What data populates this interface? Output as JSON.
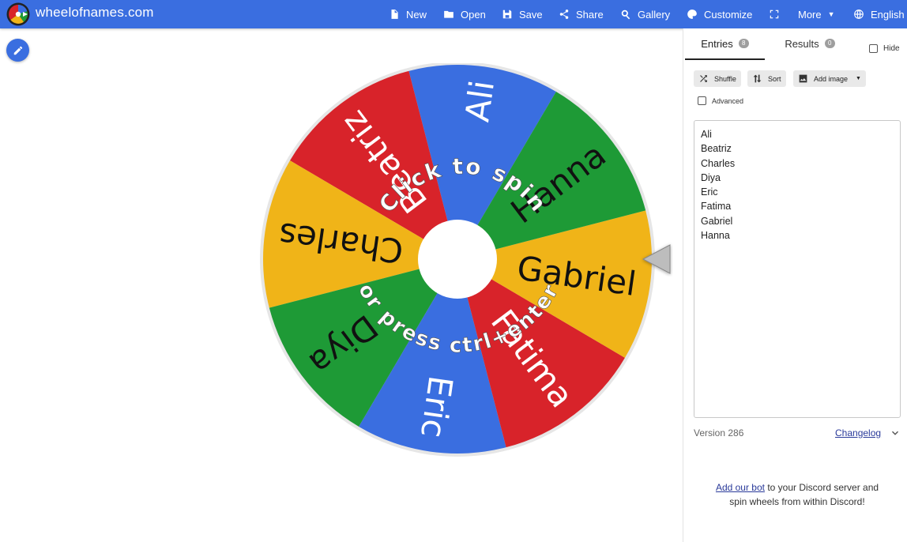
{
  "header": {
    "site_title": "wheelofnames.com",
    "nav": [
      {
        "label": "New",
        "icon": "file-icon"
      },
      {
        "label": "Open",
        "icon": "folder-icon"
      },
      {
        "label": "Save",
        "icon": "save-icon"
      },
      {
        "label": "Share",
        "icon": "share-icon"
      },
      {
        "label": "Gallery",
        "icon": "search-icon"
      },
      {
        "label": "Customize",
        "icon": "palette-icon"
      },
      {
        "label": "",
        "icon": "fullscreen-icon"
      },
      {
        "label": "More",
        "icon": "chevron-down-icon"
      },
      {
        "label": "English",
        "icon": "globe-icon"
      }
    ]
  },
  "wheel": {
    "segments": [
      {
        "name": "Ali",
        "color": "#3a6ee0"
      },
      {
        "name": "Beatriz",
        "color": "#d8232a"
      },
      {
        "name": "Charles",
        "color": "#f0b418"
      },
      {
        "name": "Diya",
        "color": "#1e9a36"
      },
      {
        "name": "Eric",
        "color": "#3a6ee0"
      },
      {
        "name": "Fatima",
        "color": "#d8232a"
      },
      {
        "name": "Gabriel",
        "color": "#f0b418"
      },
      {
        "name": "Hanna",
        "color": "#1e9a36"
      }
    ],
    "overlay_top": "Click to spin",
    "overlay_bottom": "or press ctrl+enter"
  },
  "panel": {
    "tabs": {
      "entries": {
        "label": "Entries",
        "count": "8"
      },
      "results": {
        "label": "Results",
        "count": "0"
      }
    },
    "hide_label": "Hide",
    "tools": {
      "shuffle": "Shuffle",
      "sort": "Sort",
      "add_image": "Add image"
    },
    "advanced_label": "Advanced",
    "entries_text": "Ali\nBeatriz\nCharles\nDiya\nEric\nFatima\nGabriel\nHanna",
    "version": "Version 286",
    "changelog": "Changelog",
    "discord": {
      "link": "Add our bot",
      "text": " to your Discord server and spin wheels from within Discord!"
    }
  }
}
